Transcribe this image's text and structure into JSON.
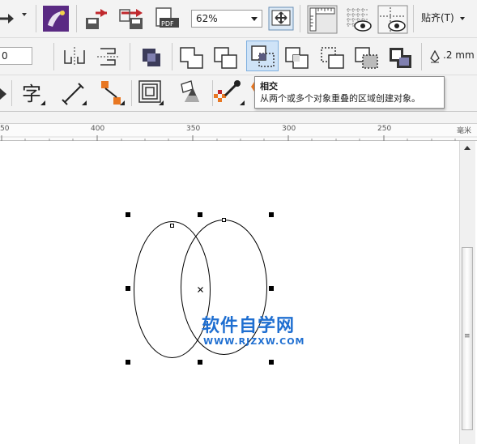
{
  "toolbar_top": {
    "zoom_level": "62%",
    "snap_label": "贴齐(T)",
    "icons": [
      "redo-icon",
      "corel-launcher-icon",
      "import-icon",
      "export-icon",
      "export-pdf-icon",
      "full-screen-preview-icon",
      "show-rulers-icon",
      "show-grid-icon",
      "show-guidelines-icon"
    ]
  },
  "property_bar": {
    "position_value": "0",
    "outline_width": ".2 mm",
    "icons": [
      "mirror-vertical-icon",
      "mirror-horizontal-icon",
      "combine-icon",
      "weld-icon",
      "trim-icon",
      "intersect-icon",
      "simplify-icon",
      "front-minus-back-icon",
      "back-minus-front-icon",
      "create-boundary-icon",
      "outline-pen-icon"
    ]
  },
  "toolbox": {
    "icons": [
      "shape-tool-icon",
      "text-tool-icon",
      "dimension-tool-icon",
      "connector-tool-icon",
      "contour-tool-icon",
      "transparency-tool-icon",
      "eyedropper-tool-icon",
      "smart-fill-icon",
      "paint-bucket-icon"
    ]
  },
  "tooltip": {
    "title": "相交",
    "description": "从两个或多个对象重叠的区域创建对象。"
  },
  "ruler": {
    "labels": [
      "50",
      "400",
      "350",
      "300",
      "250"
    ],
    "unit": "毫米"
  },
  "watermark": {
    "text": "软件自学网",
    "url": "WWW.RJZXW.COM"
  }
}
